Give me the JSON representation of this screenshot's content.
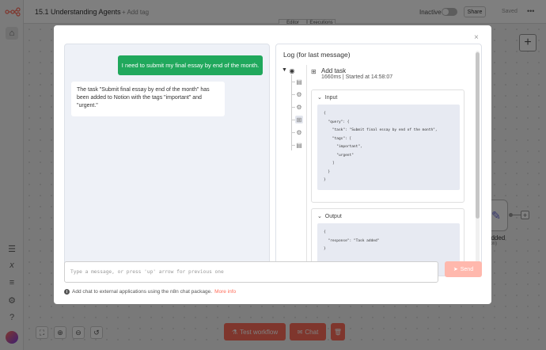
{
  "app": {
    "workflow_title": "15.1 Understanding Agents",
    "add_tag": "+ Add tag",
    "inactive_label": "Inactive",
    "share_label": "Share",
    "saved_label": "Saved",
    "more_label": "•••",
    "view_tabs": [
      "Editor",
      "Executions"
    ],
    "plus_label": "+",
    "bg_node": {
      "label": "added",
      "sub": "ion)"
    },
    "bottom": {
      "test_workflow": "Test workflow",
      "chat": "Chat"
    },
    "sidebar_icons": [
      "home-icon",
      "templates-icon",
      "variables-icon",
      "executions-icon",
      "settings-icon",
      "help-icon",
      "avatar"
    ],
    "zoom_icons": [
      "fit-view-icon",
      "zoom-in-icon",
      "zoom-out-icon",
      "reset-zoom-icon"
    ]
  },
  "modal": {
    "close_label": "×",
    "chat": {
      "user_message": "I need to submit my final essay by end of the month.",
      "bot_message": "The task \"Submit final essay by end of the month\" has been added to Notion with the tags \"important\" and \"urgent.\""
    },
    "log": {
      "title": "Log (for last message)",
      "tree_icons": [
        "agent-icon",
        "database-icon",
        "gear-icon",
        "gear-icon",
        "tool-icon",
        "gear-icon",
        "database-icon"
      ],
      "task_name": "Add task",
      "task_meta": "1660ms | Started at 14:58:07",
      "input_label": "Input",
      "input_json": "{\n  \"query\": {\n    \"task\": \"Submit final essay by end of the month\",\n    \"tags\": [\n      \"important\",\n      \"urgent\"\n    ]\n  }\n}",
      "output_label": "Output",
      "output_json": "{\n  \"response\": \"Task added\"\n}"
    },
    "input_placeholder": "Type a message, or press 'up' arrow for previous one",
    "send_label": "Send",
    "footer_text": "Add chat to external applications using the n8n chat package.",
    "footer_link": "More info",
    "accent_color": "#ff6d5a",
    "user_bubble_color": "#20a85c"
  }
}
